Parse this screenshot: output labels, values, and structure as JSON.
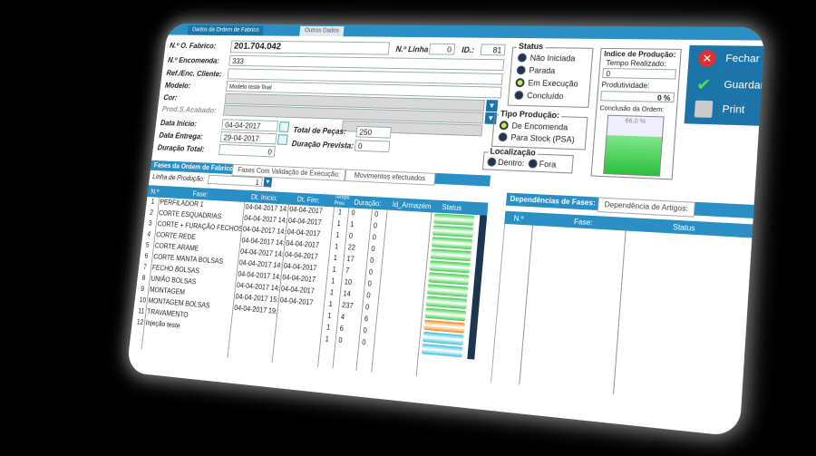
{
  "tabs": {
    "active": "Dados da Ordem de Fabrico",
    "inactive": "Outros Dados"
  },
  "form": {
    "ordem_label": "N.º O. Fabrico:",
    "ordem_value": "201.704.042",
    "linha_label": "N.º Linha",
    "linha_value": "0",
    "id_label": "ID.:",
    "id_value": "81",
    "encomenda_label": "N.º Encomenda:",
    "encomenda_value": "333",
    "ref_cliente_label": "Ref./Enc. Cliente:",
    "ref_cliente_value": "",
    "modelo_label": "Modelo:",
    "modelo_value": "Modelo teste final",
    "cor_label": "Cor:",
    "acabado_label": "Prod.S.Acabado:",
    "data_inicio_label": "Data Inicio:",
    "data_inicio_value": "04-04-2017",
    "data_entrega_label": "Data Entrega:",
    "data_entrega_value": "29-04-2017",
    "duracao_total_label": "Duração Total:",
    "duracao_total_value": "0",
    "total_pecas_label": "Total de Peças:",
    "total_pecas_value": "250",
    "duracao_prevista_label": "Duração Prevista:",
    "duracao_prevista_value": "0"
  },
  "status": {
    "title": "Status",
    "options": [
      "Não Iniciada",
      "Parada",
      "Em Execução",
      "Concluído"
    ],
    "selected_index": 2
  },
  "tipo_producao": {
    "title": "Tipo Produção:",
    "options": [
      "De Encomenda",
      "Para Stock (PSA)"
    ],
    "selected_index": 0
  },
  "localizacao": {
    "title": "Localização",
    "options": [
      "Dentro:",
      "Fora"
    ]
  },
  "indice": {
    "title": "Indice de Produção:",
    "tempo_label": "Tempo Realizado:",
    "tempo_value": "0",
    "produtividade_label": "Produtividade:",
    "produtividade_value": "0 %",
    "conclusao_label": "Conclusão da Ordem:",
    "conclusao_value": "66,0 %",
    "conclusao_fraction": 0.66
  },
  "actions": {
    "fechar": "Fechar",
    "guardar": "Guardar",
    "print": "Print"
  },
  "phases_tabs": {
    "active": "Fases da Ordem de Fabrico:",
    "t2": "Fases Com Validação de Execução:",
    "t3": "Movimentos efectuados"
  },
  "linha_producao": {
    "label": "Linha de Produção:",
    "value": "1"
  },
  "phases_headers": [
    "N.º",
    "Fase:",
    "Dt. Inicio:",
    "Dt. Fim:",
    "Tempo Prev.",
    "Duração:",
    "Id_Armazém",
    "Status"
  ],
  "phases": [
    {
      "n": "1",
      "fase": "PERFILADOR 1",
      "inicio": "04-04-2017 14:",
      "fim": "04-04-2017",
      "prev": "1",
      "dur": "0",
      "arm": "0",
      "status": "green"
    },
    {
      "n": "2",
      "fase": "CORTE ESQUADRIAS",
      "inicio": "04-04-2017 14:",
      "fim": "04-04-2017",
      "prev": "1",
      "dur": "1",
      "arm": "0",
      "status": "green"
    },
    {
      "n": "3",
      "fase": "CORTE + FURAÇÃO FECHOS",
      "inicio": "04-04-2017 14:",
      "fim": "04-04-2017",
      "prev": "1",
      "dur": "0",
      "arm": "0",
      "status": "green"
    },
    {
      "n": "4",
      "fase": "CORTE REDE",
      "inicio": "04-04-2017 14:",
      "fim": "04-04-2017",
      "prev": "1",
      "dur": "22",
      "arm": "0",
      "status": "green"
    },
    {
      "n": "5",
      "fase": "CORTE ARAME",
      "inicio": "04-04-2017 14:",
      "fim": "04-04-2017",
      "prev": "1",
      "dur": "17",
      "arm": "0",
      "status": "green"
    },
    {
      "n": "6",
      "fase": "CORTE MANTA BOLSAS",
      "inicio": "04-04-2017 14:",
      "fim": "04-04-2017",
      "prev": "1",
      "dur": "7",
      "arm": "0",
      "status": "green"
    },
    {
      "n": "7",
      "fase": "FECHO BOLSAS",
      "inicio": "04-04-2017 14:",
      "fim": "04-04-2017",
      "prev": "1",
      "dur": "10",
      "arm": "0",
      "status": "green"
    },
    {
      "n": "8",
      "fase": "UNIÃO BOLSAS",
      "inicio": "04-04-2017 14:",
      "fim": "04-04-2017",
      "prev": "1",
      "dur": "14",
      "arm": "0",
      "status": "green"
    },
    {
      "n": "9",
      "fase": "MONTAGEM",
      "inicio": "04-04-2017 15:",
      "fim": "04-04-2017",
      "prev": "1",
      "dur": "237",
      "arm": "0",
      "status": "green"
    },
    {
      "n": "10",
      "fase": "MONTAGEM BOLSAS",
      "inicio": "04-04-2017 19:",
      "fim": "",
      "prev": "1",
      "dur": "4",
      "arm": "6",
      "status": "orange"
    },
    {
      "n": "11",
      "fase": "TRAVAMENTO",
      "inicio": "",
      "fim": "",
      "prev": "1",
      "dur": "6",
      "arm": "0",
      "status": "cyan"
    },
    {
      "n": "12",
      "fase": "Injeção teste",
      "inicio": "",
      "fim": "",
      "prev": "1",
      "dur": "0",
      "arm": "0",
      "status": "cyan"
    }
  ],
  "deps_tabs": {
    "active": "Dependências de Fases:",
    "t2": "Dependência de Artigos:"
  },
  "deps_headers": [
    "N.º",
    "Fase:",
    "Status"
  ],
  "colors": {
    "accent": "#2a8fc4",
    "dark_accent": "#1c74a8",
    "green": "#3fcf4a",
    "orange": "#f08a1c",
    "cyan": "#3cc0e0"
  }
}
